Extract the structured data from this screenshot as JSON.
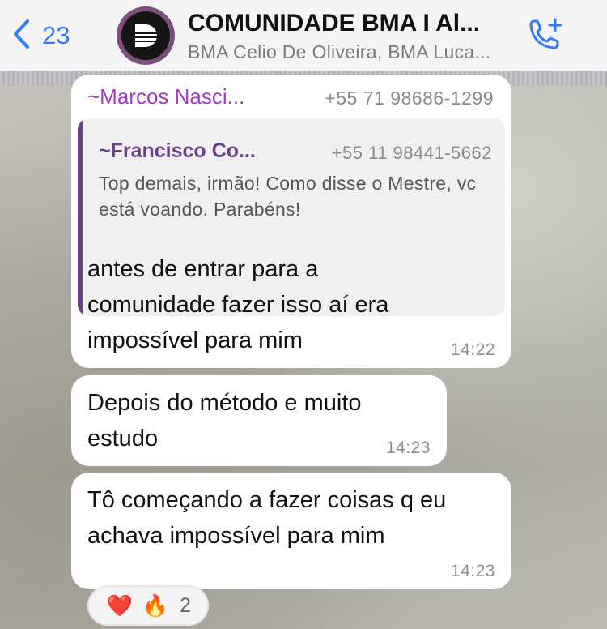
{
  "header": {
    "back_count": "23",
    "title": "COMUNIDADE BMA I Al...",
    "subtitle": "BMA Celio De Oliveira, BMA Luca..."
  },
  "messages": [
    {
      "sender_name": "~Marcos Nasci...",
      "sender_phone": "+55 71 98686-1299",
      "quote": {
        "name": "~Francisco Co...",
        "phone": "+55 11 98441-5662",
        "text": "Top demais, irmão! Como disse o Mestre, vc está voando. Parabéns!"
      },
      "text": "antes de entrar para a comunidade fazer isso aí era impossível para mim",
      "time": "14:22"
    },
    {
      "text": "Depois do método e muito estudo",
      "time": "14:23"
    },
    {
      "text": "Tô começando a fazer coisas q eu achava impossível para mim",
      "time": "14:23"
    }
  ],
  "reactions": {
    "emojis": [
      "❤️",
      "🔥"
    ],
    "count": "2"
  },
  "colors": {
    "accent_blue": "#2f7cf6",
    "sender_purple": "#a33bc7",
    "quote_purple": "#6b3f8c",
    "bubble_bg": "#ffffff",
    "header_bg": "#f6f6f6"
  },
  "icons": {
    "back": "chevron-left-icon",
    "call": "phone-add-icon",
    "avatar": "group-logo-d"
  }
}
